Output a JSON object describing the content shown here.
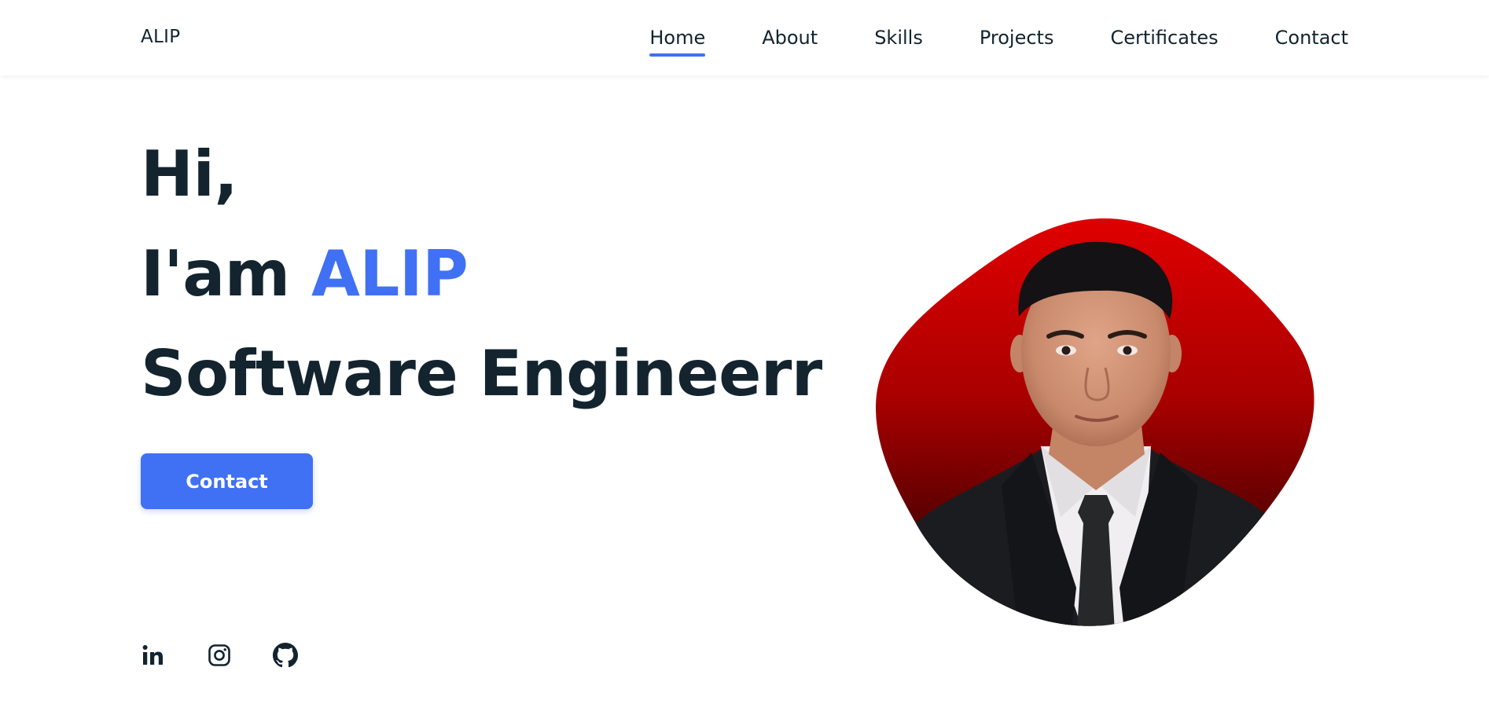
{
  "brand": {
    "logo_text": "ALIP"
  },
  "nav": {
    "items": [
      {
        "label": "Home",
        "active": true
      },
      {
        "label": "About",
        "active": false
      },
      {
        "label": "Skills",
        "active": false
      },
      {
        "label": "Projects",
        "active": false
      },
      {
        "label": "Certificates",
        "active": false
      },
      {
        "label": "Contact",
        "active": false
      }
    ]
  },
  "hero": {
    "greeting": "Hi,",
    "intro_prefix": "I'am",
    "name": "ALIP",
    "role": "Software Engineerr",
    "cta_label": "Contact"
  },
  "socials": [
    {
      "icon": "linkedin-icon"
    },
    {
      "icon": "instagram-icon"
    },
    {
      "icon": "github-icon"
    }
  ],
  "colors": {
    "accent": "#4070f4",
    "title": "#13242f",
    "photo_background_top": "#e00000",
    "photo_background_bottom": "#4a0000",
    "suit": "#1b1c20",
    "shirt": "#f0eef0",
    "tie": "#26282a"
  }
}
